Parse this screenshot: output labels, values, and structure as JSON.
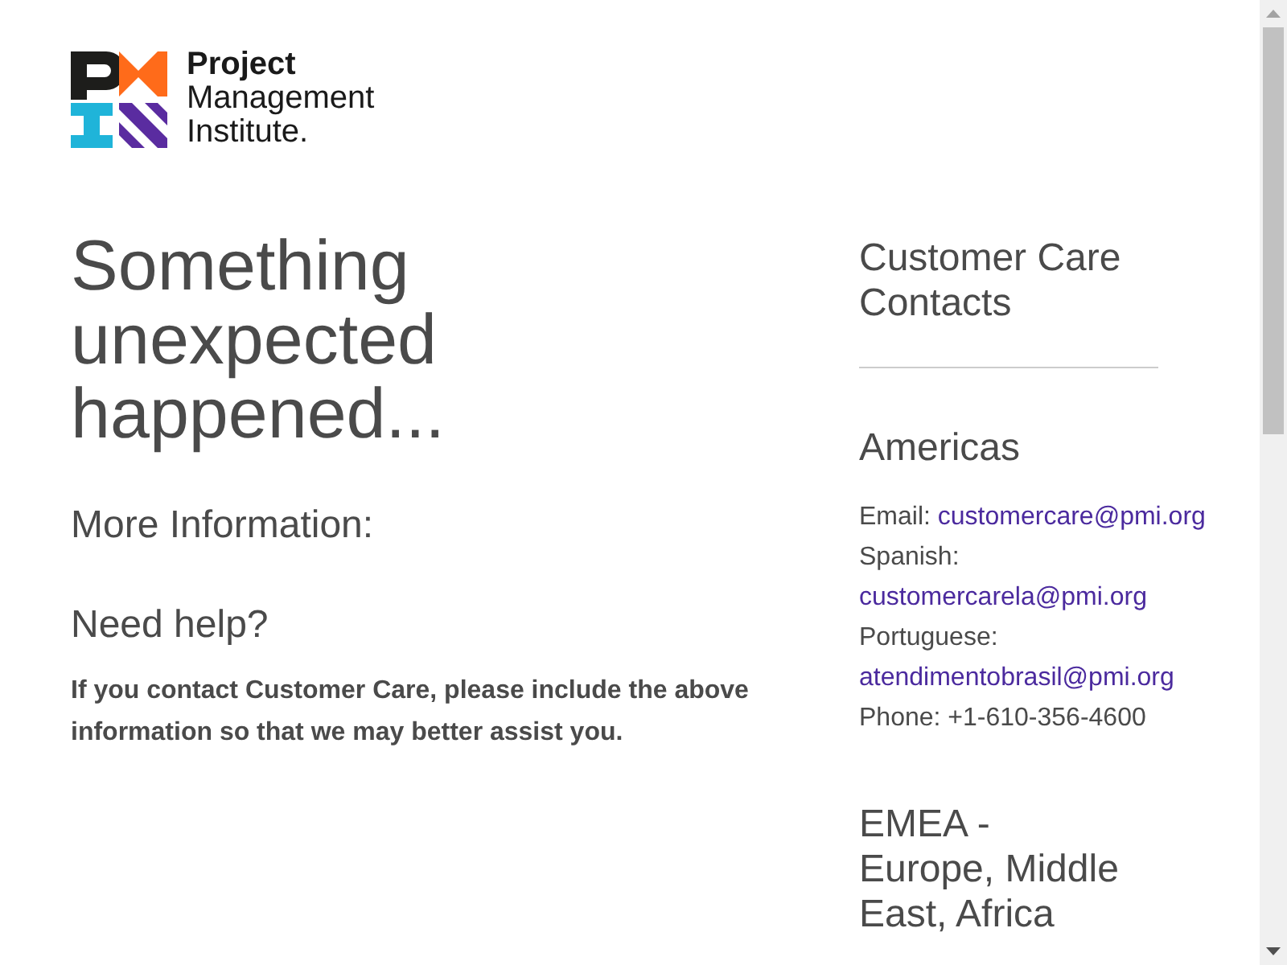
{
  "logo": {
    "lines": [
      "Project",
      "Management",
      "Institute."
    ]
  },
  "main": {
    "title": "Something unexpected happened...",
    "more_info": "More Information:",
    "help_heading": "Need help?",
    "help_text": "If you contact Customer Care, please include the above information so that we may better assist you."
  },
  "contacts": {
    "title": "Customer Care Contacts",
    "regions": [
      {
        "name_lines": [
          "Americas"
        ],
        "lines": [
          {
            "label": "Email:",
            "link": "customercare@pmi.org",
            "kind": "inline"
          },
          {
            "label": "Spanish:",
            "link": "customercarela@pmi.org",
            "kind": "wrapped"
          },
          {
            "label": "Portuguese:",
            "link": "atendimentobrasil@pmi.org",
            "kind": "wrapped"
          },
          {
            "label": "Phone: +1-610-356-4600",
            "kind": "text"
          }
        ]
      },
      {
        "name_lines": [
          "EMEA -",
          "Europe, Middle",
          "East, Africa"
        ]
      }
    ]
  }
}
